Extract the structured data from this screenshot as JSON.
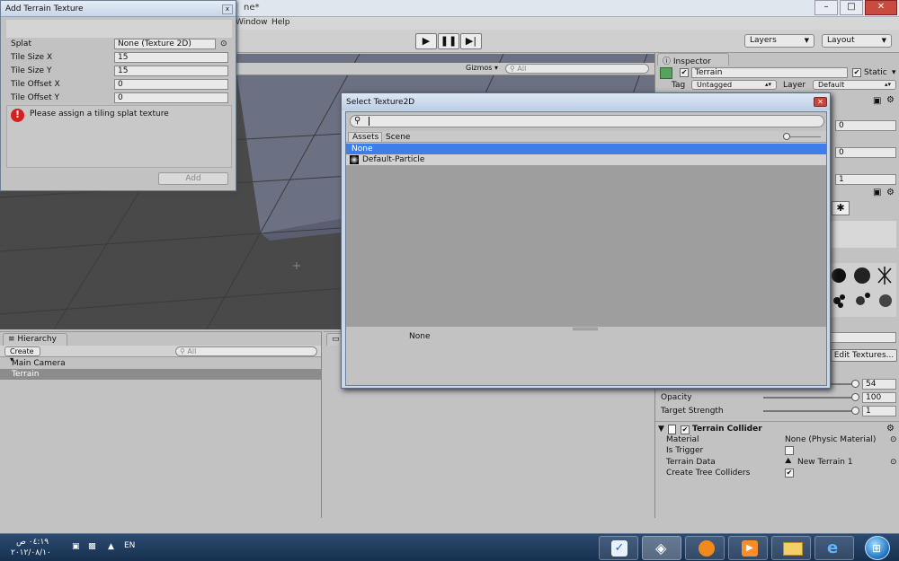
{
  "titlebar": {
    "suffix": "ne*"
  },
  "menu": {
    "window": "Window",
    "help": "Help"
  },
  "toolbar": {
    "layers": "Layers",
    "layout": "Layout"
  },
  "scene": {
    "gizmos": "Gizmos",
    "search_placeholder": "All"
  },
  "add_terrain_dialog": {
    "title": "Add Terrain Texture",
    "fields": [
      {
        "label": "Splat",
        "value": "None (Texture 2D)"
      },
      {
        "label": "Tile Size X",
        "value": "15"
      },
      {
        "label": "Tile Size Y",
        "value": "15"
      },
      {
        "label": "Tile Offset X",
        "value": "0"
      },
      {
        "label": "Tile Offset Y",
        "value": "0"
      }
    ],
    "error": "Please assign a tiling splat texture",
    "add_button": "Add"
  },
  "select_dialog": {
    "title": "Select Texture2D",
    "tabs": [
      "Assets",
      "Scene"
    ],
    "items": [
      "None",
      "Default-Particle"
    ],
    "preview_label": "None"
  },
  "hierarchy": {
    "tab": "Hierarchy",
    "create": "Create",
    "search_placeholder": "All",
    "items": [
      "Main Camera",
      "Terrain"
    ]
  },
  "inspector": {
    "tab": "Inspector",
    "object_name": "Terrain",
    "static_label": "Static",
    "tag_label": "Tag",
    "tag_value": "Untagged",
    "layer_label": "Layer",
    "layer_value": "Default",
    "numbers": [
      "0",
      "0",
      "1"
    ],
    "edit_textures": "Edit Textures...",
    "brush": [
      {
        "label": "",
        "value": "54"
      },
      {
        "label": "Opacity",
        "value": "100"
      },
      {
        "label": "Target Strength",
        "value": "1"
      }
    ],
    "collider": {
      "title": "Terrain Collider",
      "rows": [
        {
          "label": "Material",
          "value": "None (Physic Material)"
        },
        {
          "label": "Is Trigger",
          "value": ""
        },
        {
          "label": "Terrain Data",
          "value": "New Terrain 1"
        },
        {
          "label": "Create Tree Colliders",
          "value": ""
        }
      ]
    }
  },
  "taskbar": {
    "time": "٠٤:١٩ ص",
    "date": "٢٠١٢/٠٨/١٠",
    "lang": "EN"
  }
}
